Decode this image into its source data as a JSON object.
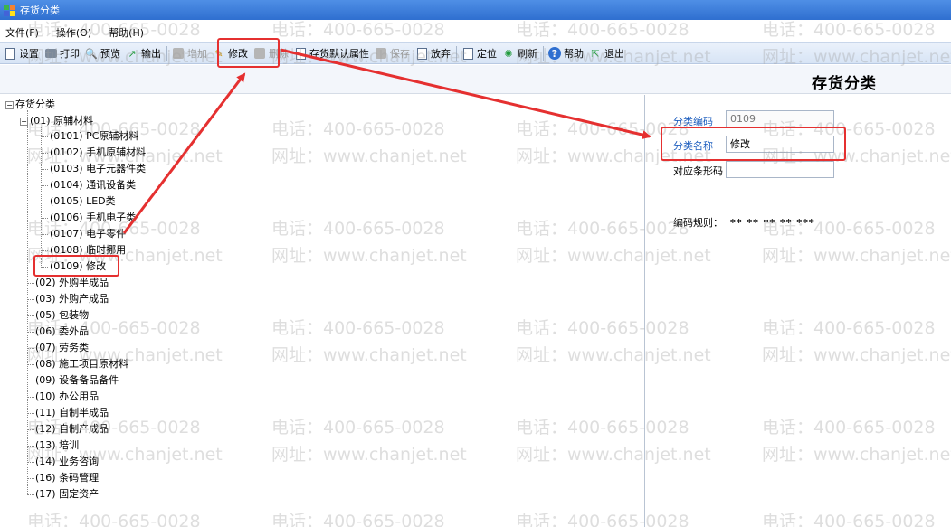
{
  "window": {
    "title": "存货分类"
  },
  "menu": [
    "文件(F)",
    "操作(O)",
    "帮助(H)"
  ],
  "toolbar": [
    {
      "label": "设置",
      "icon": "settings-icon",
      "enabled": true
    },
    {
      "label": "打印",
      "icon": "print-icon",
      "enabled": true
    },
    {
      "label": "预览",
      "icon": "preview-icon",
      "enabled": true
    },
    {
      "label": "输出",
      "icon": "export-icon",
      "enabled": true
    },
    {
      "label": "增加",
      "icon": "add-icon",
      "enabled": false
    },
    {
      "label": "修改",
      "icon": "edit-icon",
      "enabled": true
    },
    {
      "label": "删除",
      "icon": "delete-icon",
      "enabled": false
    },
    {
      "label": "存货默认属性",
      "icon": "inventory-default-icon",
      "enabled": true
    },
    {
      "label": "保存",
      "icon": "save-icon",
      "enabled": false
    },
    {
      "label": "放弃",
      "icon": "discard-icon",
      "enabled": true
    },
    {
      "label": "定位",
      "icon": "locate-icon",
      "enabled": true
    },
    {
      "label": "刷新",
      "icon": "refresh-icon",
      "enabled": true
    },
    {
      "label": "帮助",
      "icon": "help-icon",
      "enabled": true
    },
    {
      "label": "退出",
      "icon": "exit-icon",
      "enabled": true
    }
  ],
  "page_title": "存货分类",
  "tree": {
    "root": "存货分类",
    "children": [
      {
        "label": "(01) 原辅材料",
        "children": [
          "(0101) PC原辅材料",
          "(0102) 手机原辅材料",
          "(0103) 电子元器件类",
          "(0104) 通讯设备类",
          "(0105) LED类",
          "(0106) 手机电子类",
          "(0107) 电子零件",
          "(0108) 临时挪用",
          "(0109) 修改"
        ]
      },
      {
        "label": "(02) 外购半成品"
      },
      {
        "label": "(03) 外购产成品"
      },
      {
        "label": "(05) 包装物"
      },
      {
        "label": "(06) 委外品"
      },
      {
        "label": "(07) 劳务类"
      },
      {
        "label": "(08) 施工项目原材料"
      },
      {
        "label": "(09) 设备备品备件"
      },
      {
        "label": "(10) 办公用品"
      },
      {
        "label": "(11) 自制半成品"
      },
      {
        "label": "(12) 自制产成品"
      },
      {
        "label": "(13) 培训"
      },
      {
        "label": "(14) 业务咨询"
      },
      {
        "label": "(16) 条码管理"
      },
      {
        "label": "(17) 固定资产"
      }
    ]
  },
  "form": {
    "code_label": "分类编码",
    "code_value": "0109",
    "name_label": "分类名称",
    "name_value": "修改",
    "barcode_label": "对应条形码",
    "barcode_value": "",
    "rule_label": "编码规则：",
    "rule_value": "** ** ** ** ***"
  },
  "watermark": {
    "phone": "电话：400-665-0028",
    "site": "网址：www.chanjet.net"
  },
  "colors": {
    "annotation": "#e53030",
    "title_bar": "#2f6fd0",
    "label_link": "#1f5fbf"
  }
}
